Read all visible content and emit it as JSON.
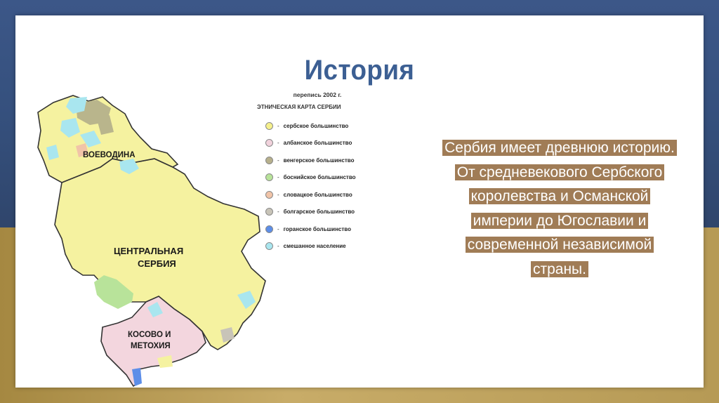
{
  "slide": {
    "title": "История"
  },
  "map": {
    "regions": {
      "vojvodina": "ВОЕВОДИНА",
      "central_line1": "ЦЕНТРАЛЬНАЯ",
      "central_line2": "СЕРБИЯ",
      "kosovo_line1": "КОСОВО И",
      "kosovo_line2": "МЕТОХИЯ"
    },
    "legend": {
      "census": "перепись 2002 г.",
      "title": "ЭТНИЧЕСКАЯ КАРТА СЕРБИИ",
      "items": [
        {
          "label": "сербское большинство",
          "color": "#f5f08c"
        },
        {
          "label": "албанское большинство",
          "color": "#f1d2dc"
        },
        {
          "label": "венгерское большинство",
          "color": "#b7b08c"
        },
        {
          "label": "боснийское большинство",
          "color": "#b8e39a"
        },
        {
          "label": "словацкое большинство",
          "color": "#f1c4a8"
        },
        {
          "label": "болгарское большинство",
          "color": "#c8c4b8"
        },
        {
          "label": "горанское большинство",
          "color": "#5d8ee8"
        },
        {
          "label": "смешанное население",
          "color": "#a9e6ef"
        }
      ]
    }
  },
  "text": {
    "lines": [
      "Сербия имеет древнюю историю.",
      "От средневекового Сербского",
      "королевства и Османской",
      "империи до Югославии и",
      "современной независимой",
      "страны."
    ]
  },
  "colors": {
    "title": "#3c5f93",
    "text_highlight": "#a07c56"
  }
}
